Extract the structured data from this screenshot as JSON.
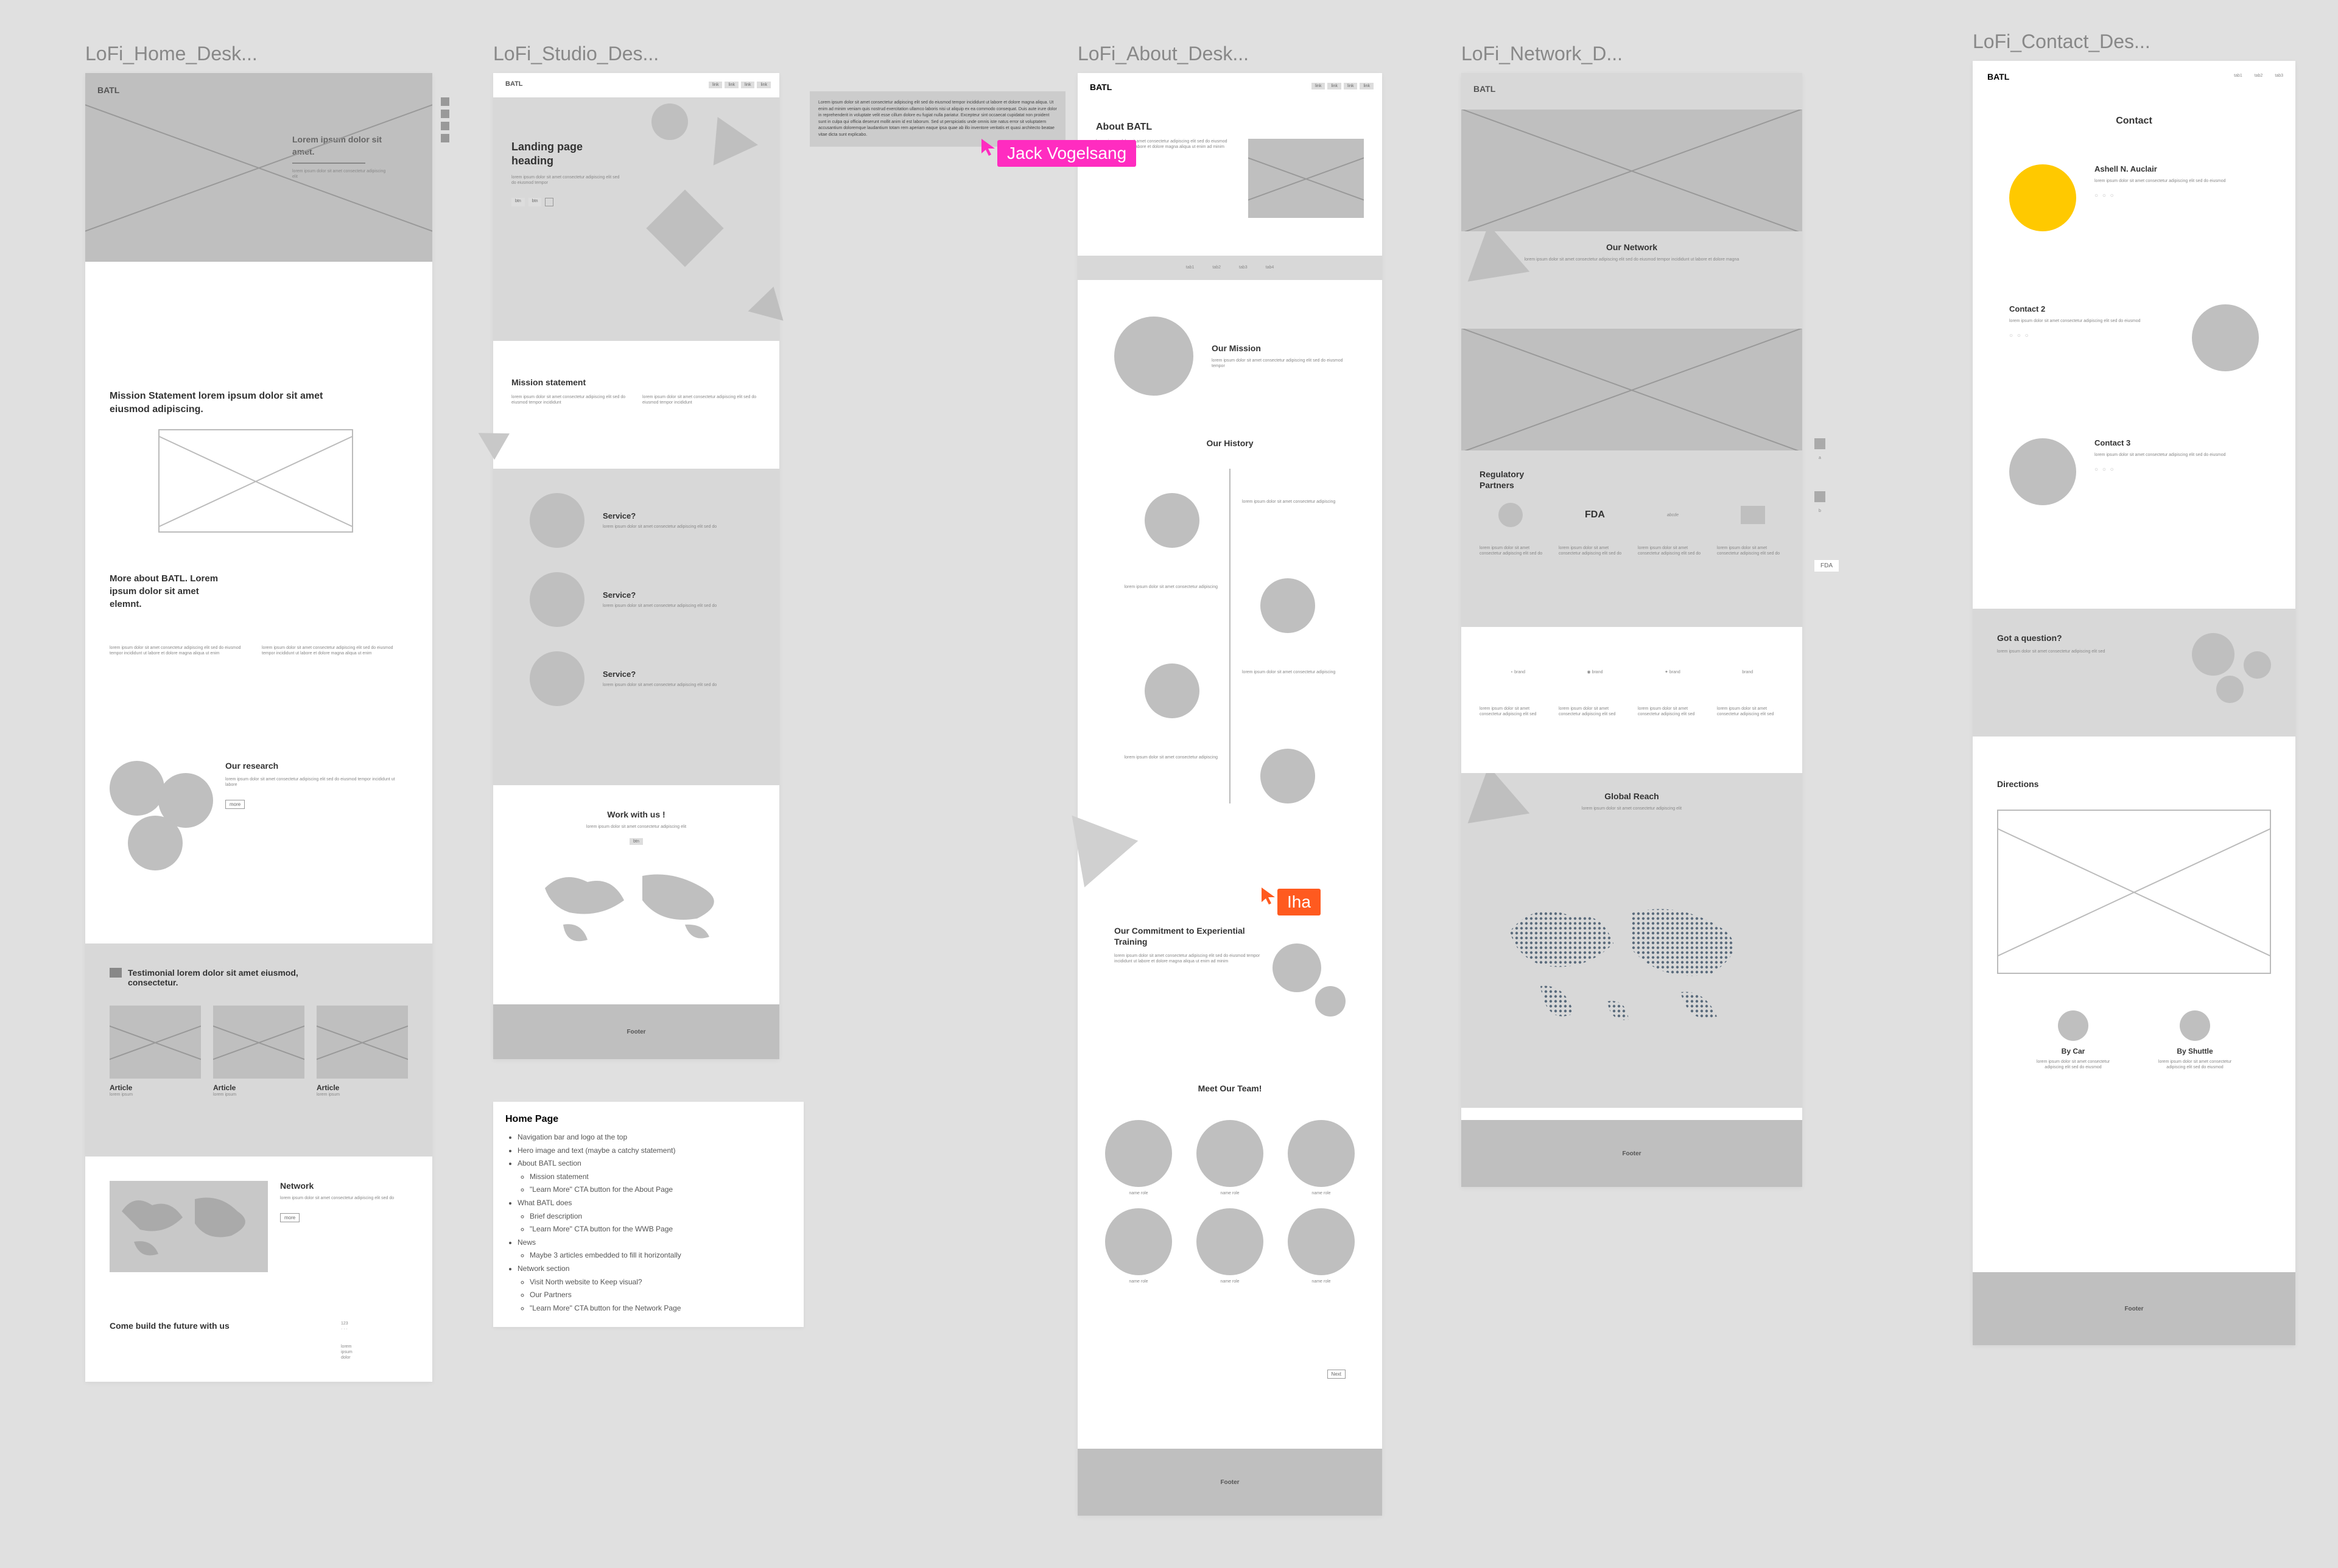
{
  "frames": {
    "home": {
      "label": "LoFi_Home_Desk..."
    },
    "studio": {
      "label": "LoFi_Studio_Des..."
    },
    "about": {
      "label": "LoFi_About_Desk..."
    },
    "network": {
      "label": "LoFi_Network_D..."
    },
    "contact": {
      "label": "LoFi_Contact_Des..."
    }
  },
  "cursors": {
    "pink": {
      "name": "Jack Vogelsang",
      "color": "#ff2cc0"
    },
    "orange": {
      "name": "Iha",
      "color": "#ff5a1f"
    }
  },
  "side": {
    "fda": "FDA"
  },
  "home": {
    "logo": "BATL",
    "hero_text": "Lorem ipsum dolor sit amet.",
    "mission": "Mission Statement lorem ipsum dolor sit amet eiusmod adipiscing.",
    "more_title": "More about BATL. Lorem ipsum dolor sit amet elemnt.",
    "research": "Our research",
    "testimonial": "Testimonial lorem dolor sit amet eiusmod, consectetur.",
    "article": "Article",
    "network": "Network",
    "cta": "Come build the future with us"
  },
  "studio": {
    "logo": "BATL",
    "heading": "Landing page heading",
    "mission": "Mission statement",
    "service": "Service?",
    "work": "Work with us !",
    "footer": "Footer"
  },
  "about": {
    "logo": "BATL",
    "title": "About BATL",
    "mission": "Our Mission",
    "history": "Our History",
    "commitment": "Our Commitment to Experiential Training",
    "team": "Meet Our Team!",
    "footer": "Footer",
    "next": "Next"
  },
  "network": {
    "logo": "BATL",
    "title": "Our Network",
    "regulatory": "Regulatory Partners",
    "fda": "FDA",
    "reach": "Global Reach",
    "footer": "Footer"
  },
  "contact": {
    "logo": "BATL",
    "title": "Contact",
    "c1": "Ashell N. Auclair",
    "c2": "Contact 2",
    "c3": "Contact 3",
    "question": "Got a question?",
    "directions": "Directions",
    "bycar": "By Car",
    "byshuttle": "By Shuttle",
    "footer": "Footer",
    "nav1": "tab1",
    "nav2": "tab2",
    "nav3": "tab3"
  },
  "notes": {
    "title": "Home Page",
    "i1": "Navigation bar and logo at the top",
    "i2": "Hero image and text (maybe a catchy statement)",
    "i3": "About BATL section",
    "i3a": "Mission statement",
    "i3b": "\"Learn More\" CTA button for the About Page",
    "i4": "What BATL does",
    "i4a": "Brief description",
    "i4b": "\"Learn More\" CTA button for the WWB Page",
    "i5": "News",
    "i5a": "Maybe 3 articles embedded to fill it horizontally",
    "i6": "Network section",
    "i6a": "Visit North website to Keep visual?",
    "i6b": "Our Partners",
    "i6c": "\"Learn More\" CTA button for the Network Page"
  }
}
